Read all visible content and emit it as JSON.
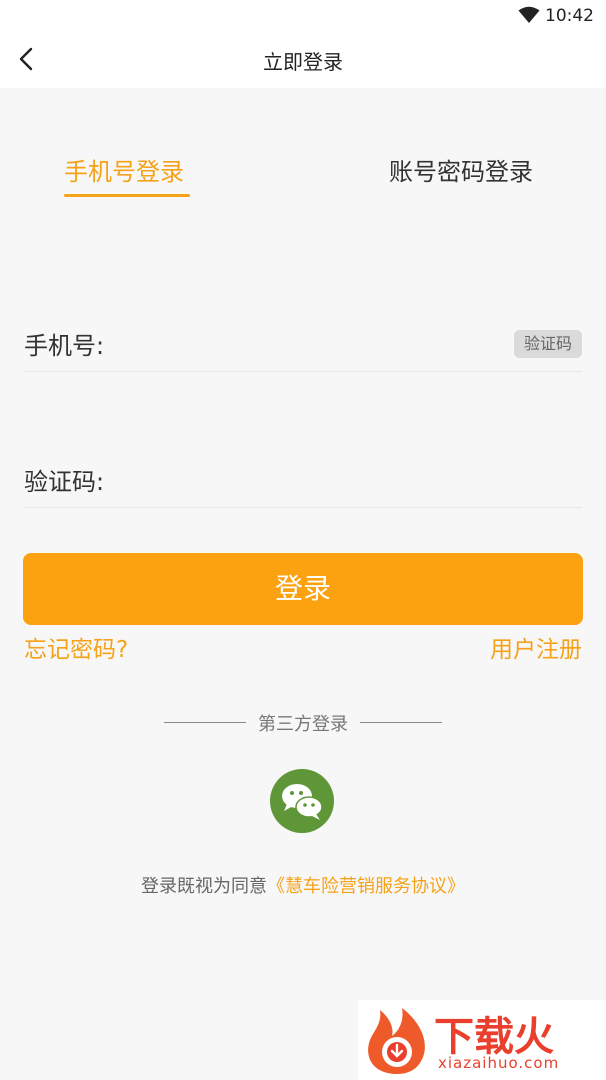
{
  "status_bar": {
    "time": "10:42",
    "icon": "wifi-icon"
  },
  "title_bar": {
    "title": "立即登录",
    "back_icon": "back-arrow-icon"
  },
  "tabs": [
    {
      "label": "手机号登录",
      "active": true
    },
    {
      "label": "账号密码登录",
      "active": false
    }
  ],
  "form": {
    "phone_label": "手机号:",
    "phone_value": "",
    "code_button": "验证码",
    "code_label": "验证码:",
    "code_value": ""
  },
  "login_button": "登录",
  "links": {
    "forgot_password": "忘记密码?",
    "register": "用户注册"
  },
  "third_party": {
    "title": "第三方登录",
    "icon": "wechat-icon"
  },
  "agreement": {
    "prefix": "登录既视为同意",
    "link": "《慧车险营销服务协议》"
  },
  "watermark": {
    "text": "下载火",
    "sub": "xiazaihuo.com",
    "icon": "fire-logo-icon"
  },
  "colors": {
    "accent": "#f5a219",
    "button": "#fca110",
    "wechat": "#5f9637"
  }
}
